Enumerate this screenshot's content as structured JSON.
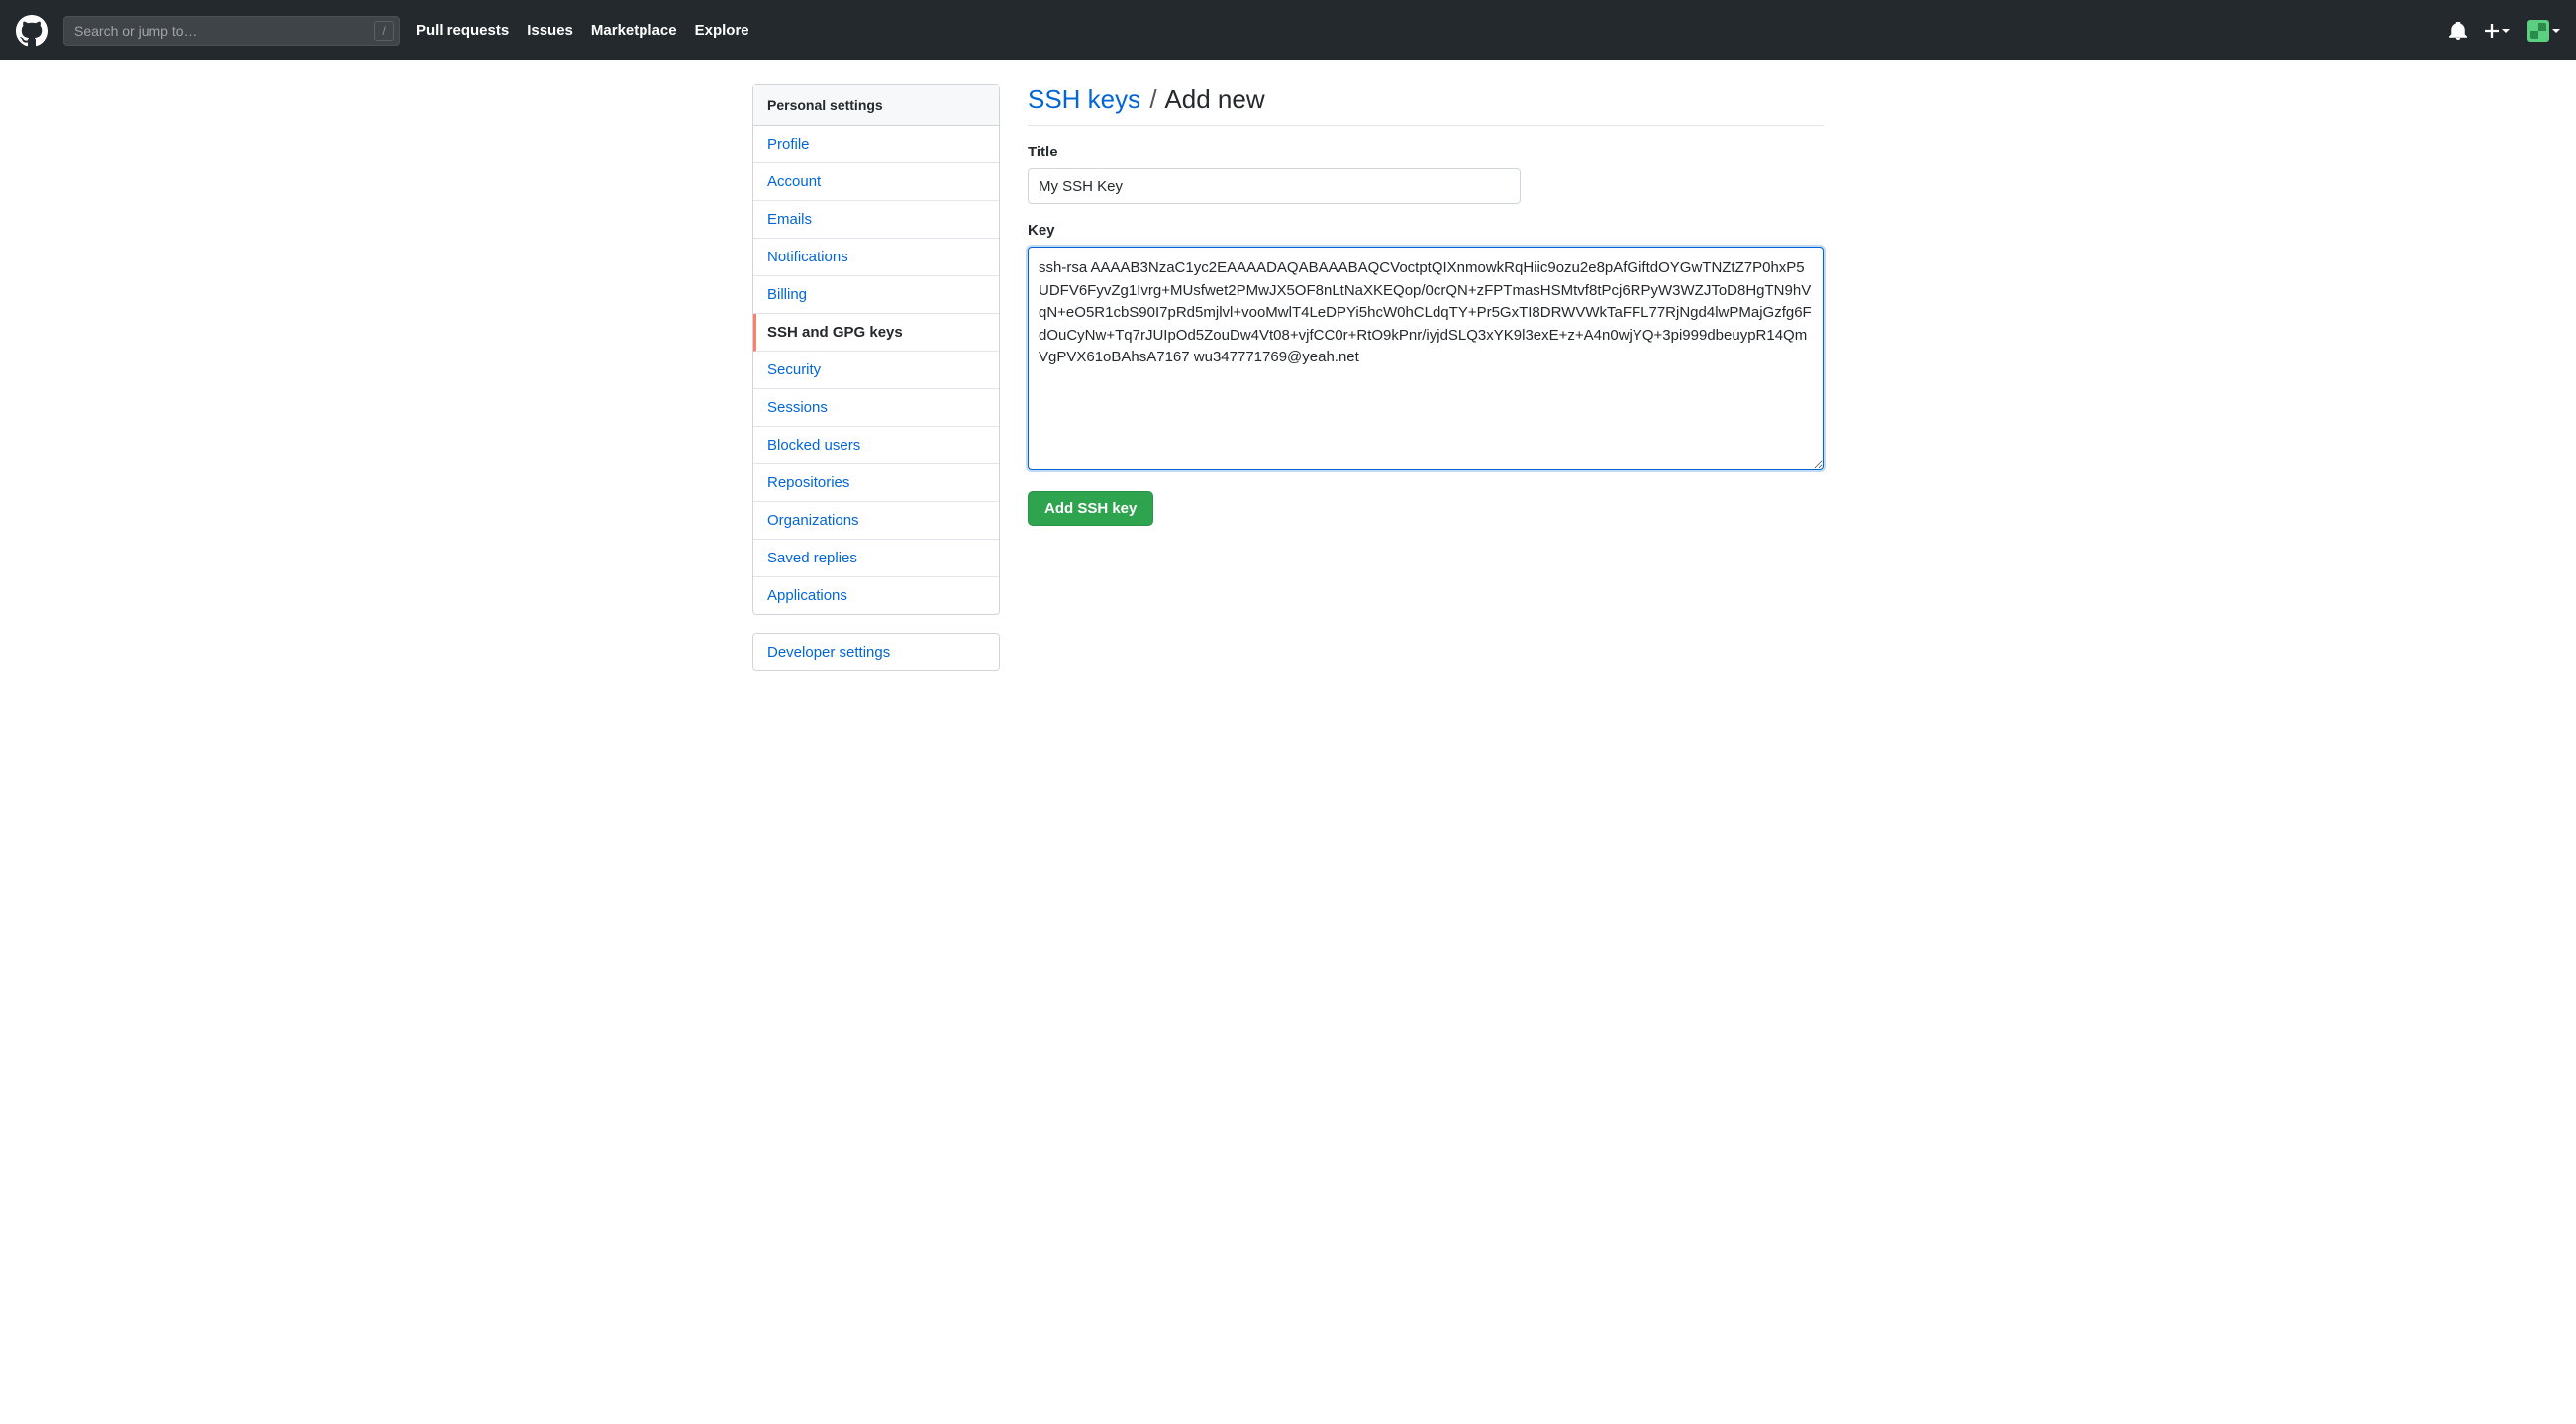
{
  "header": {
    "search_placeholder": "Search or jump to…",
    "slash_key": "/",
    "nav": [
      "Pull requests",
      "Issues",
      "Marketplace",
      "Explore"
    ]
  },
  "sidebar": {
    "header": "Personal settings",
    "items": [
      "Profile",
      "Account",
      "Emails",
      "Notifications",
      "Billing",
      "SSH and GPG keys",
      "Security",
      "Sessions",
      "Blocked users",
      "Repositories",
      "Organizations",
      "Saved replies",
      "Applications"
    ],
    "active_index": 5,
    "secondary": "Developer settings"
  },
  "page": {
    "breadcrumb_link": "SSH keys",
    "breadcrumb_sep": "/",
    "breadcrumb_current": "Add new",
    "title_label": "Title",
    "title_value": "My SSH Key",
    "key_label": "Key",
    "key_value": "ssh-rsa AAAAB3NzaC1yc2EAAAADAQABAAABAQCVoctptQIXnmowkRqHiic9ozu2e8pAfGiftdOYGwTNZtZ7P0hxP5UDFV6FyvZg1Ivrg+MUsfwet2PMwJX5OF8nLtNaXKEQop/0crQN+zFPTmasHSMtvf8tPcj6RPyW3WZJToD8HgTN9hVqN+eO5R1cbS90I7pRd5mjlvl+vooMwlT4LeDPYi5hcW0hCLdqTY+Pr5GxTI8DRWVWkTaFFL77RjNgd4lwPMajGzfg6FdOuCyNw+Tq7rJUIpOd5ZouDw4Vt08+vjfCC0r+RtO9kPnr/iyjdSLQ3xYK9l3exE+z+A4n0wjYQ+3pi999dbeuypR14QmVgPVX61oBAhsA7167 wu347771769@yeah.net",
    "submit_label": "Add SSH key"
  }
}
